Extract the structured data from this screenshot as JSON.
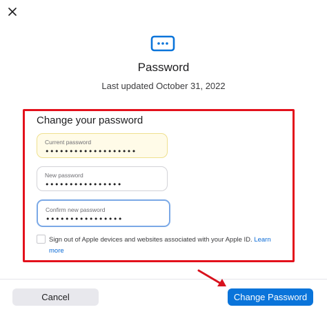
{
  "header": {
    "close_icon": "close-icon",
    "key_icon": "password-dots-icon",
    "title": "Password",
    "subtitle": "Last updated October 31, 2022"
  },
  "form": {
    "section_title": "Change your password",
    "current": {
      "label": "Current password",
      "value": "•••••••••••••••••••"
    },
    "new": {
      "label": "New password",
      "value": "••••••••••••••••"
    },
    "confirm": {
      "label": "Confirm new password",
      "value": "••••••••••••••••"
    },
    "signout_text": "Sign out of Apple devices and websites associated with your Apple ID.",
    "learn_more": "Learn more",
    "signout_checked": false
  },
  "footer": {
    "cancel_label": "Cancel",
    "submit_label": "Change Password"
  },
  "colors": {
    "highlight_frame": "#e3101b",
    "accent": "#0a74da",
    "arrow": "#d8121d"
  }
}
